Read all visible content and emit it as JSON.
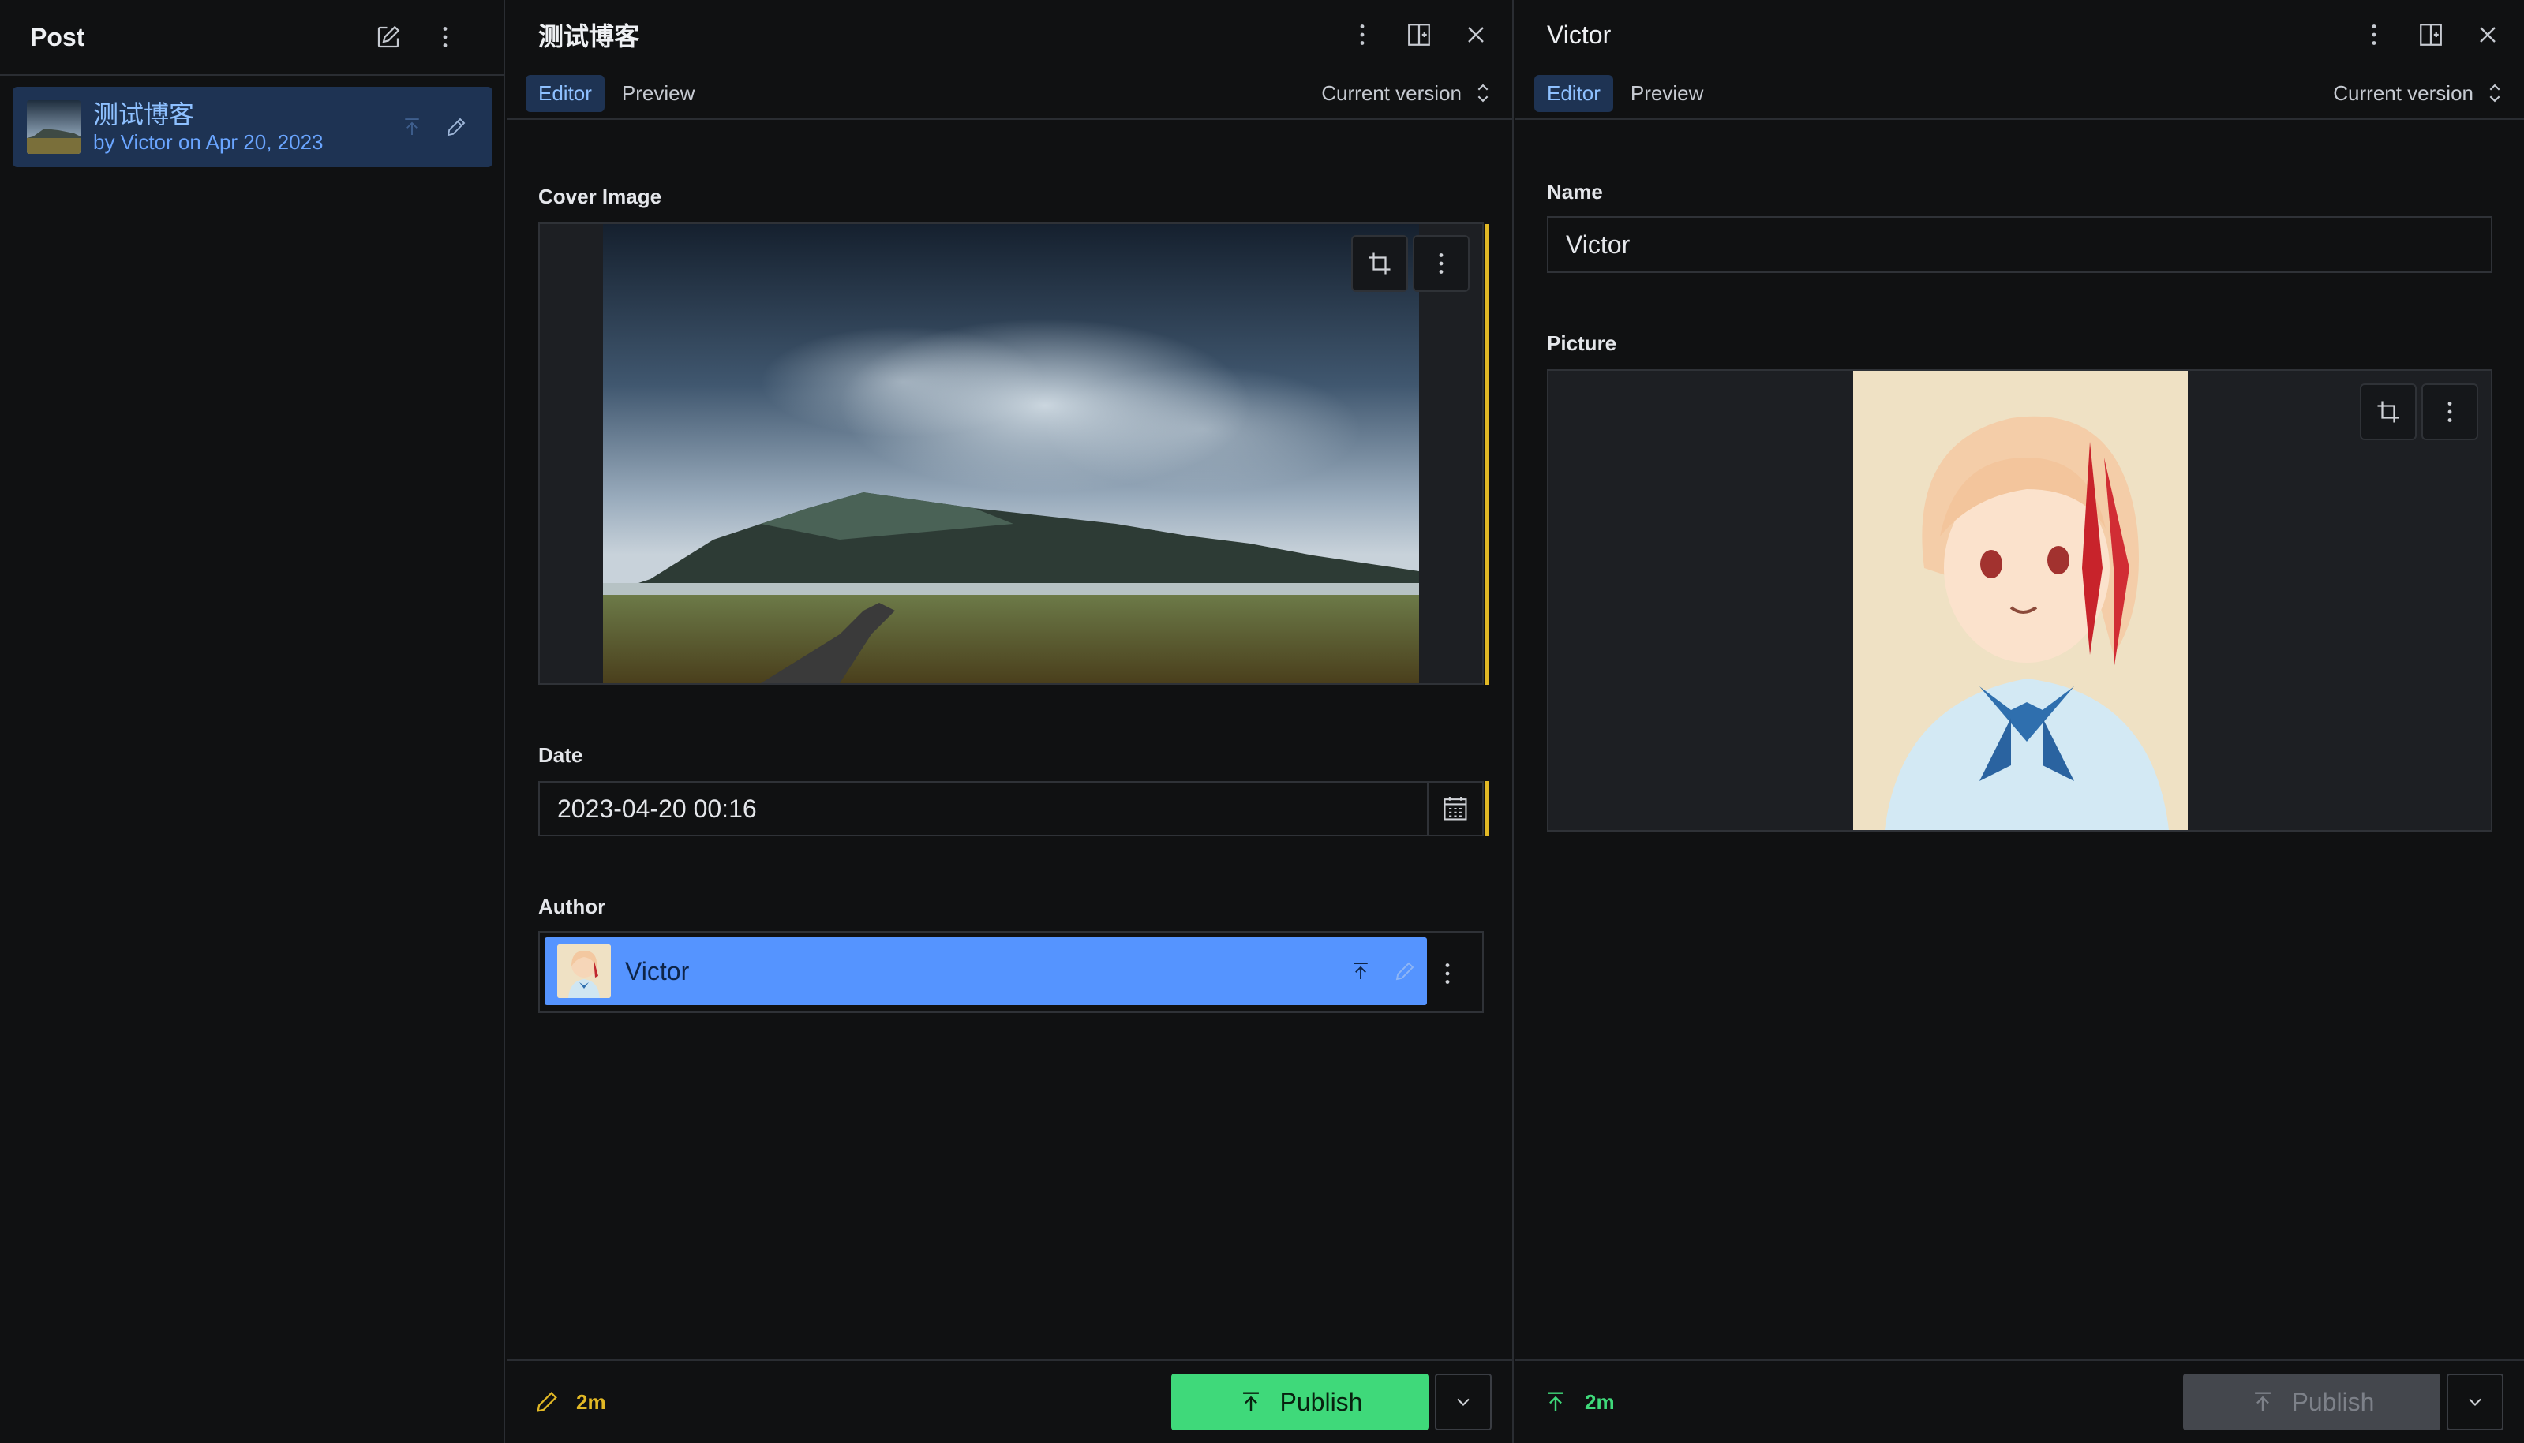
{
  "list_pane": {
    "title": "Post",
    "items": [
      {
        "title": "测试博客",
        "subtitle": "by Victor on Apr 20, 2023"
      }
    ]
  },
  "post_pane": {
    "title": "测试博客",
    "tabs": [
      "Editor",
      "Preview"
    ],
    "version_label": "Current version",
    "cover_label": "Cover Image",
    "date_label": "Date",
    "date_value": "2023-04-20 00:16",
    "author_label": "Author",
    "author_ref": "Victor",
    "footer_status": "2m",
    "publish_label": "Publish"
  },
  "author_pane": {
    "title": "Victor",
    "tabs": [
      "Editor",
      "Preview"
    ],
    "version_label": "Current version",
    "name_label": "Name",
    "name_value": "Victor",
    "picture_label": "Picture",
    "footer_status": "2m",
    "publish_label": "Publish"
  },
  "colors": {
    "background": "#101112",
    "selected": "#1e3353",
    "accent_blue": "#5594ff",
    "publish_green": "#3fd97a",
    "status_yellow": "#e1b825",
    "status_green": "#3fd97a"
  },
  "icons": [
    "compose-icon",
    "more-vertical-icon",
    "split-pane-icon",
    "close-icon",
    "publish-arrow-icon",
    "edit-pencil-icon",
    "crop-icon",
    "calendar-icon",
    "chevron-down-icon",
    "sort-arrows-icon"
  ]
}
